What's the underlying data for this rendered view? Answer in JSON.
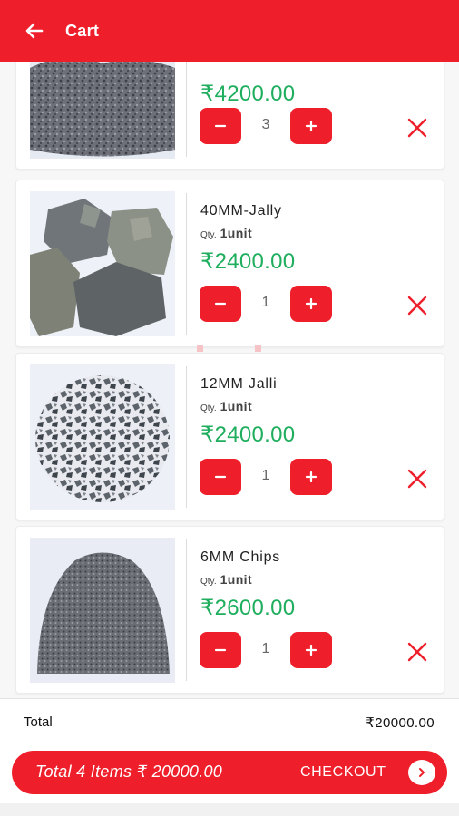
{
  "appbar": {
    "title": "Cart",
    "back_icon": "arrow-left-icon"
  },
  "colors": {
    "accent": "#ee1f2b",
    "price": "#1fae5e"
  },
  "cart": {
    "items": [
      {
        "name": "",
        "qty_label": "",
        "qty_value": "",
        "price": "₹4200.00",
        "quantity": "3",
        "image": "stone-dust-photo"
      },
      {
        "name": "40MM-Jally",
        "qty_label": "Qty.",
        "qty_value": "1unit",
        "price": "₹2400.00",
        "quantity": "1",
        "image": "large-rocks-photo"
      },
      {
        "name": "12MM Jalli",
        "qty_label": "Qty.",
        "qty_value": "1unit",
        "price": "₹2400.00",
        "quantity": "1",
        "image": "gravel-photo"
      },
      {
        "name": "6MM Chips",
        "qty_label": "Qty.",
        "qty_value": "1unit",
        "price": "₹2600.00",
        "quantity": "1",
        "image": "chips-photo"
      }
    ]
  },
  "total": {
    "label": "Total",
    "value": "₹20000.00"
  },
  "checkout": {
    "summary": "Total 4 Items ₹ 20000.00",
    "label": "CHECKOUT",
    "icon": "chevron-right-icon"
  }
}
